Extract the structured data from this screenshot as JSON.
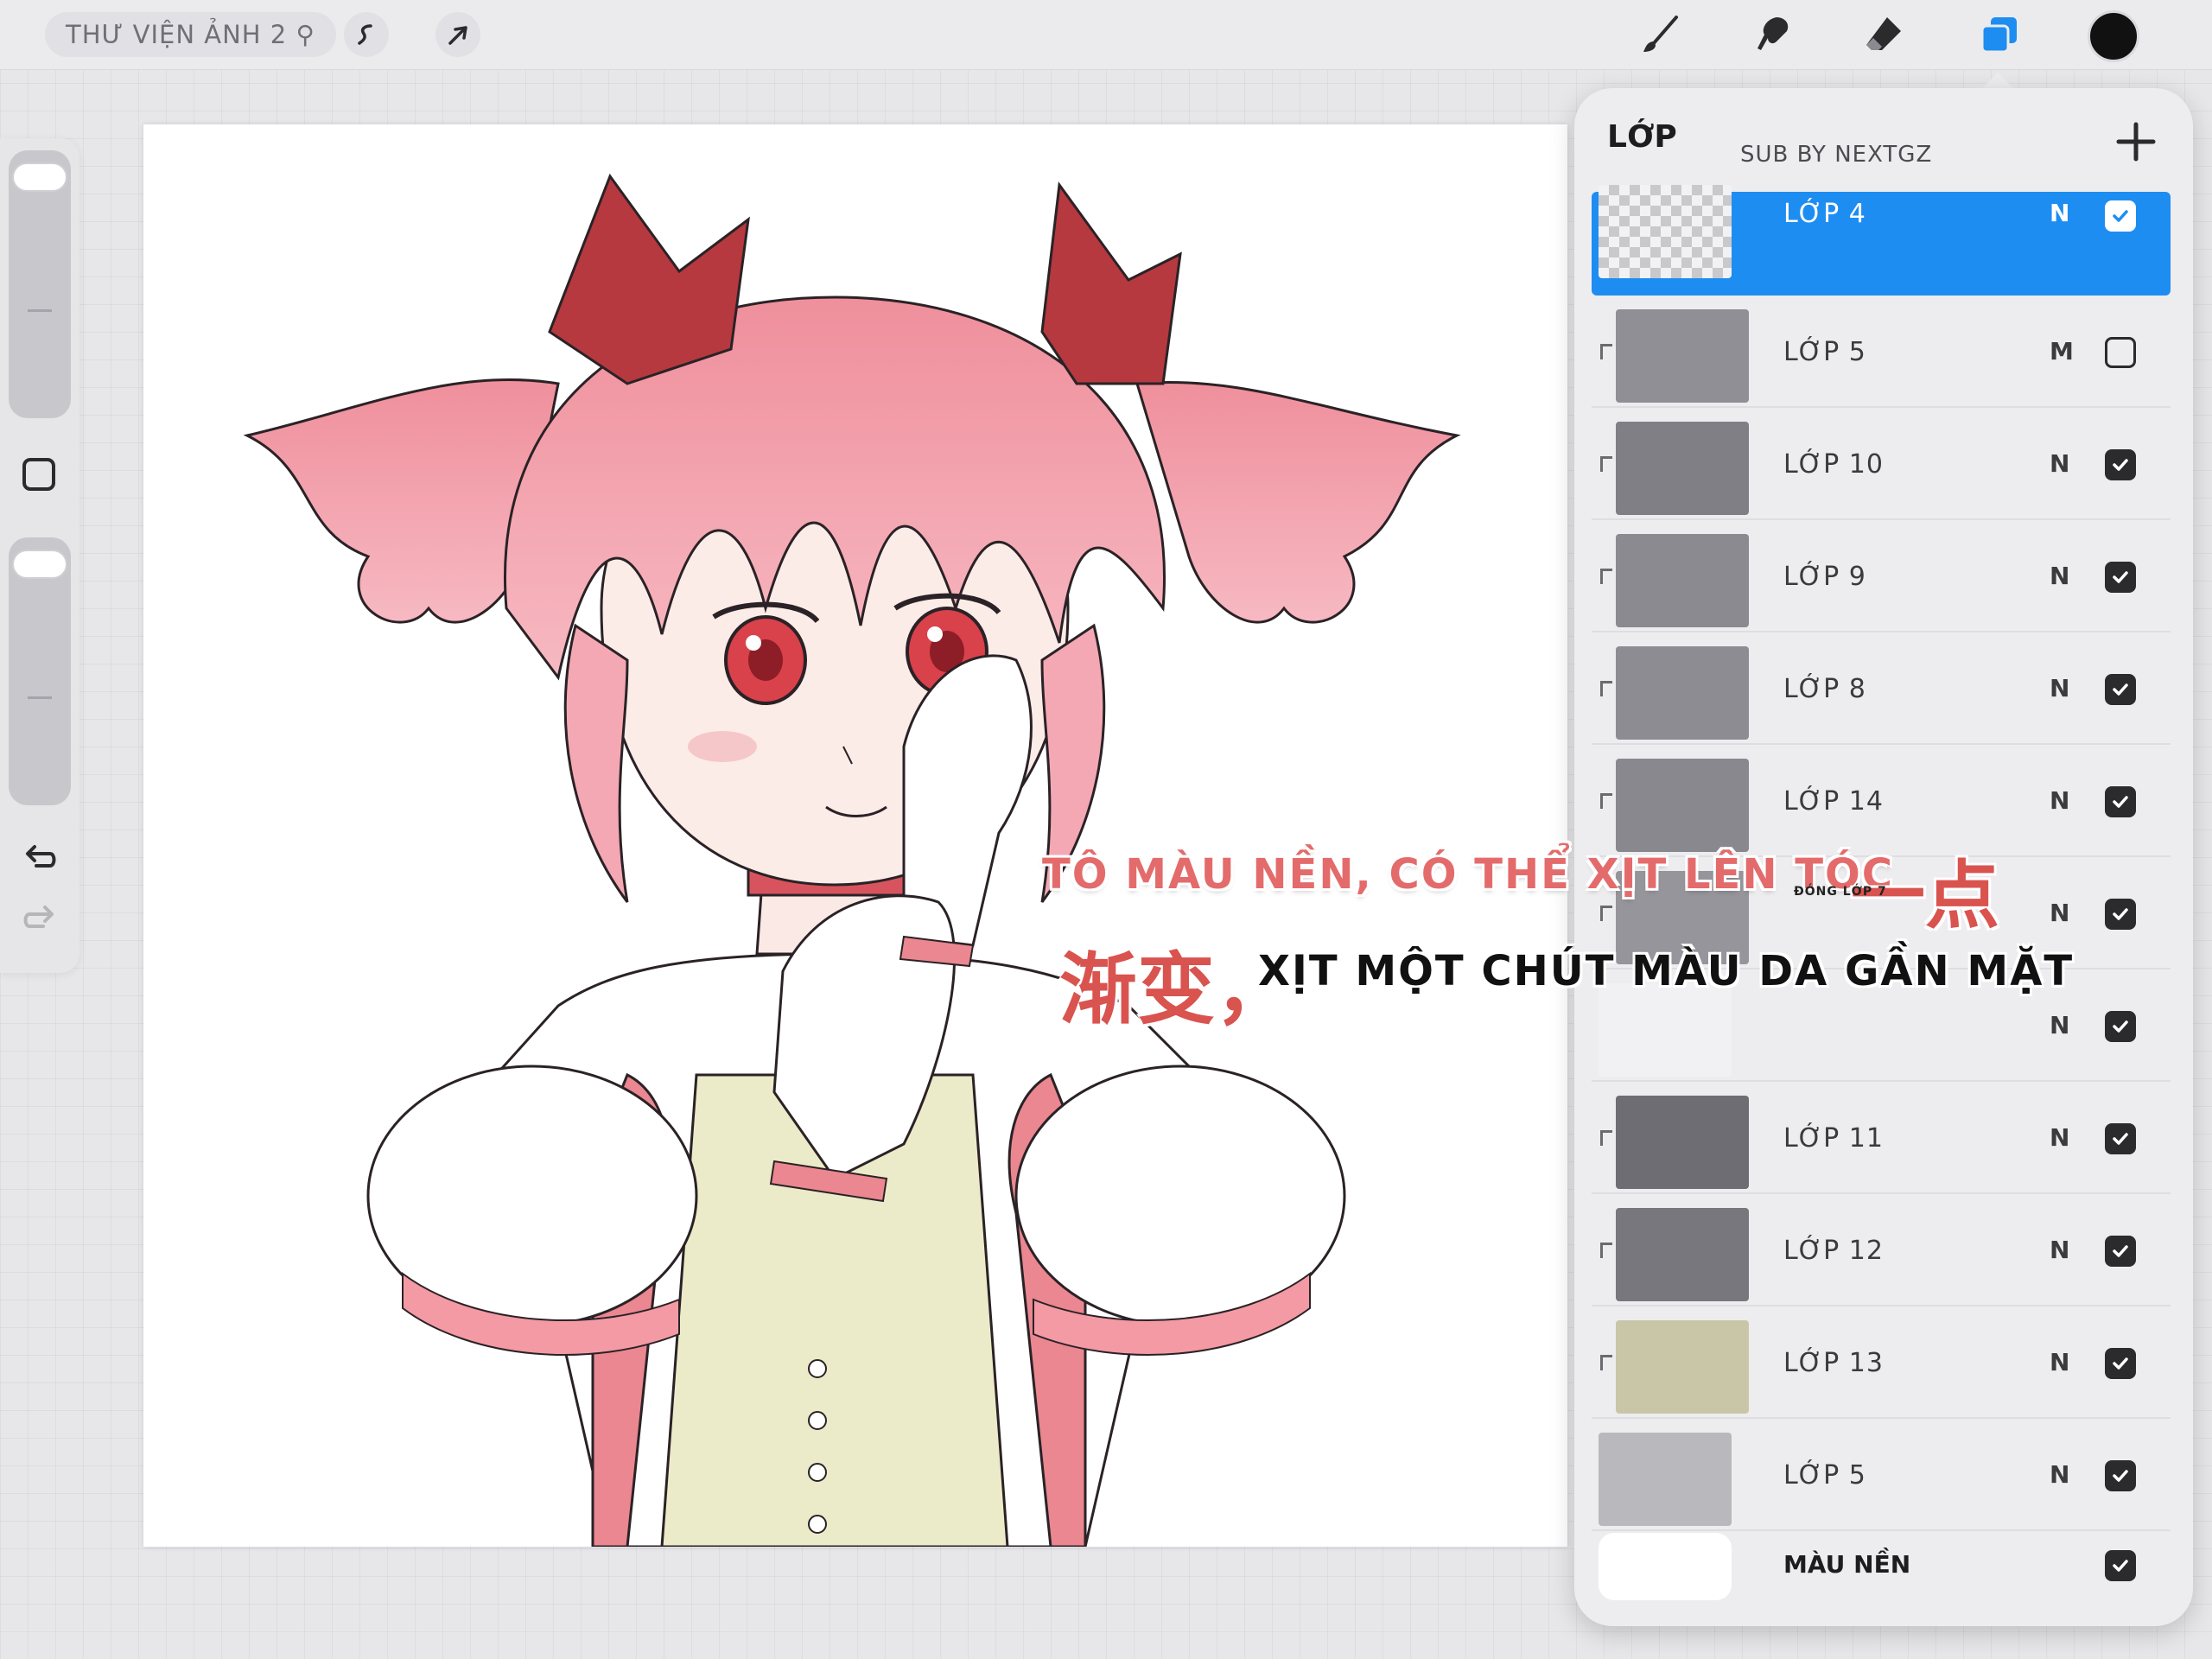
{
  "topbar": {
    "gallery_label": "THƯ VIỆN ẢNH 2 ⚲",
    "tools": [
      "brush-icon",
      "smudge-icon",
      "eraser-icon",
      "layers-icon"
    ],
    "active_tool": "layers-icon",
    "current_color": "#111111",
    "accent_color": "#1e8df2"
  },
  "layers_panel": {
    "title": "LỚP",
    "credit": "SUB BY NEXTGZ",
    "layers": [
      {
        "name": "LỚP 4",
        "mode": "N",
        "visible": true,
        "active": true,
        "clipped": false
      },
      {
        "name": "LỚP 5",
        "mode": "M",
        "visible": false,
        "active": false,
        "clipped": true
      },
      {
        "name": "LỚP 10",
        "mode": "N",
        "visible": true,
        "active": false,
        "clipped": true
      },
      {
        "name": "LỚP 9",
        "mode": "N",
        "visible": true,
        "active": false,
        "clipped": true
      },
      {
        "name": "LỚP 8",
        "mode": "N",
        "visible": true,
        "active": false,
        "clipped": true
      },
      {
        "name": "LỚP 14",
        "mode": "N",
        "visible": true,
        "active": false,
        "clipped": true
      },
      {
        "name": "",
        "mode": "N",
        "visible": true,
        "active": false,
        "clipped": true
      },
      {
        "name": "",
        "mode": "N",
        "visible": true,
        "active": false,
        "clipped": false
      },
      {
        "name": "LỚP 11",
        "mode": "N",
        "visible": true,
        "active": false,
        "clipped": true
      },
      {
        "name": "LỚP 12",
        "mode": "N",
        "visible": true,
        "active": false,
        "clipped": true
      },
      {
        "name": "LỚP 13",
        "mode": "N",
        "visible": true,
        "active": false,
        "clipped": true
      },
      {
        "name": "LỚP 5",
        "mode": "N",
        "visible": true,
        "active": false,
        "clipped": false
      }
    ],
    "background": {
      "name": "MÀU NỀN",
      "visible": true
    }
  },
  "subtitles": {
    "line1_vi": "TÔ MÀU NỀN, CÓ THỂ XỊT LÊN TÓC",
    "line1_cn": "一点",
    "line2_cn": "渐变，",
    "line2_vi": "XỊT MỘT CHÚT MÀU DA GẦN MẶT",
    "small_note": "ĐÓNG LỚP 7"
  }
}
